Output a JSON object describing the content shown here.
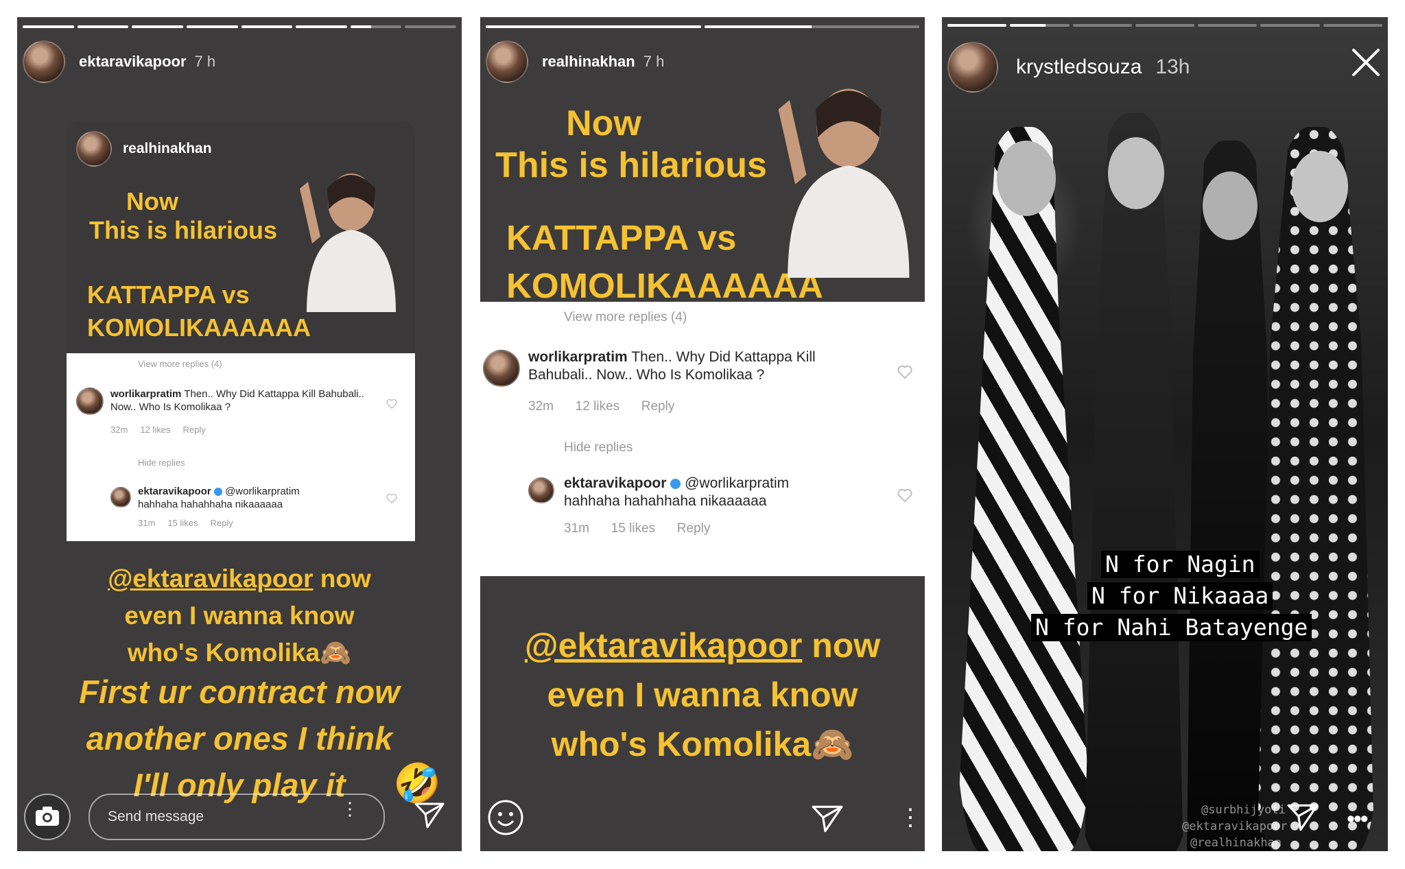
{
  "panel1": {
    "username": "ektaravikapoor",
    "time": "7 h",
    "progress": [
      1,
      1,
      1,
      1,
      1,
      1,
      0.4,
      0
    ],
    "shared_card": {
      "username": "realhinakhan",
      "line1": "Now",
      "line2": "This is hilarious",
      "line3": "KATTAPPA vs",
      "line4": "KOMOLIKAAAAAA",
      "view_more": "View more replies (4)",
      "comment1_user": "worlikarpratim",
      "comment1_text": "Then.. Why Did Kattappa Kill Bahubali.. Now.. Who Is Komolikaa ?",
      "comment1_meta_time": "32m",
      "comment1_meta_likes": "12 likes",
      "comment1_meta_reply": "Reply",
      "hide_replies": "Hide replies",
      "comment2_user": "ektaravikapoor",
      "comment2_mention": "@worlikarpratim",
      "comment2_text": "hahhaha hahahhaha nikaaaaaa",
      "comment2_meta_time": "31m",
      "comment2_meta_likes": "15 likes",
      "comment2_meta_reply": "Reply"
    },
    "mention": "@ektaravikapoor",
    "text_now": " now",
    "text_line2": "even I wanna know",
    "text_line3": "who's Komolika",
    "italic_line1": "First ur contract now",
    "italic_line2": "another ones I think",
    "italic_line3": "I'll only play it",
    "send_placeholder": "Send message",
    "emoji_monkey": "🙈",
    "emoji_laugh": "🤣"
  },
  "panel2": {
    "username": "realhinakhan",
    "time": "7 h",
    "progress": [
      1,
      0.5
    ],
    "line1": "Now",
    "line2": "This is hilarious",
    "line3": "KATTAPPA vs",
    "line4": "KOMOLIKAAAAAA",
    "view_more": "View more replies (4)",
    "comment1_user": "worlikarpratim",
    "comment1_text": "Then.. Why Did Kattappa Kill",
    "comment1_text2": "Bahubali.. Now.. Who Is Komolikaa ?",
    "comment1_meta_time": "32m",
    "comment1_meta_likes": "12 likes",
    "comment1_meta_reply": "Reply",
    "hide_replies": "Hide replies",
    "comment2_user": "ektaravikapoor",
    "comment2_mention": "@worlikarpratim",
    "comment2_text": "hahhaha hahahhaha nikaaaaaa",
    "comment2_meta_time": "31m",
    "comment2_meta_likes": "15 likes",
    "comment2_meta_reply": "Reply",
    "mention": "@ektaravikapoor",
    "text_now": " now",
    "text_line2": "even I wanna know",
    "text_line3": "who's Komolika",
    "emoji_monkey": "🙈"
  },
  "panel3": {
    "username": "krystledsouza",
    "time": "13h",
    "progress": [
      1,
      0.6,
      0,
      0,
      0,
      0,
      0
    ],
    "caption1": "N for Nagin",
    "caption2": "N for Nikaaaa",
    "caption3": "N for Nahi Batayenge",
    "mention1": "@surbhijyoti",
    "mention2": "@ektaravikapoor",
    "mention3": "@realhinakhan"
  },
  "colors": {
    "story_bg": "#3d3b3b",
    "yellow_text": "#f6c232",
    "verified_blue": "#3897f0"
  }
}
